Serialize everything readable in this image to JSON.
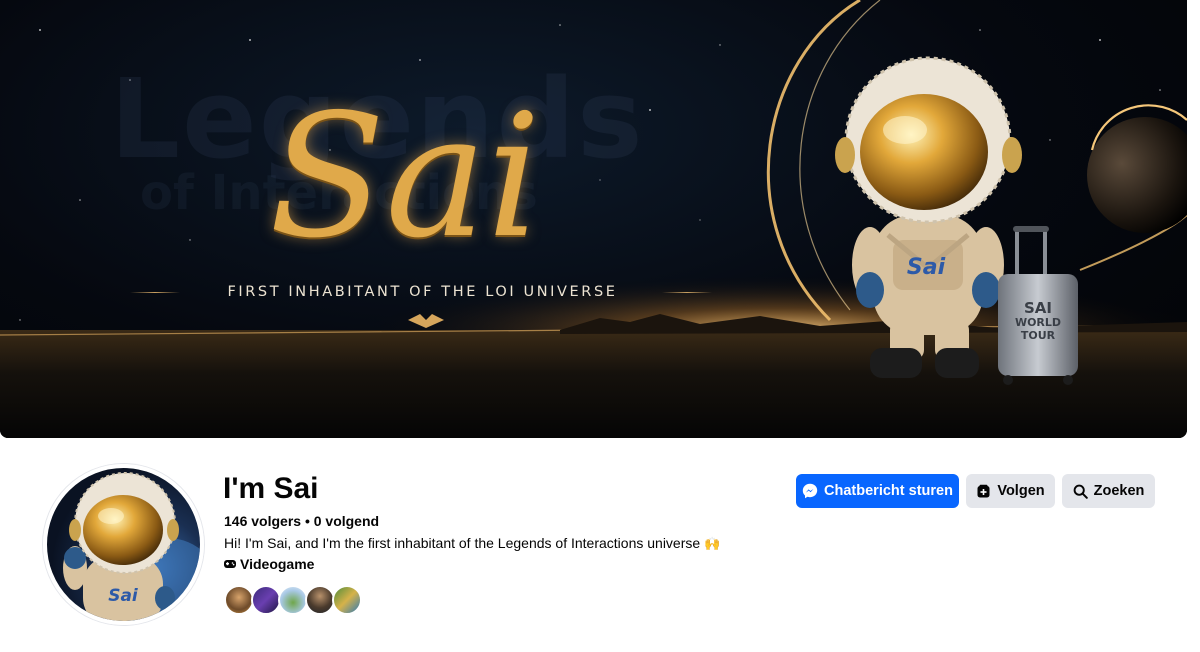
{
  "cover": {
    "title": "Sai",
    "subtitle": "FIRST INHABITANT OF THE LOI UNIVERSE",
    "watermark": "Legends",
    "watermark_sub": "of Interactions",
    "chest_label": "Sai",
    "suitcase_line1": "SAI",
    "suitcase_line2": "WORLD",
    "suitcase_line3": "TOUR"
  },
  "profile": {
    "name": "I'm Sai",
    "stats": "146 volgers • 0 volgend",
    "bio": "Hi! I'm Sai, and I'm the first inhabitant of the Legends of Interactions universe",
    "bio_emoji": "🙌",
    "category": "Videogame",
    "avatar_chest_label": "Sai"
  },
  "actions": {
    "message_label": "Chatbericht sturen",
    "follow_label": "Volgen",
    "search_label": "Zoeken"
  },
  "icons": {
    "message": "messenger-icon",
    "follow": "follow-icon",
    "search": "search-icon",
    "category": "gamepad-icon"
  },
  "colors": {
    "primary": "#0866ff",
    "secondary_button": "#e4e6eb",
    "gold": "#e0a94a"
  }
}
